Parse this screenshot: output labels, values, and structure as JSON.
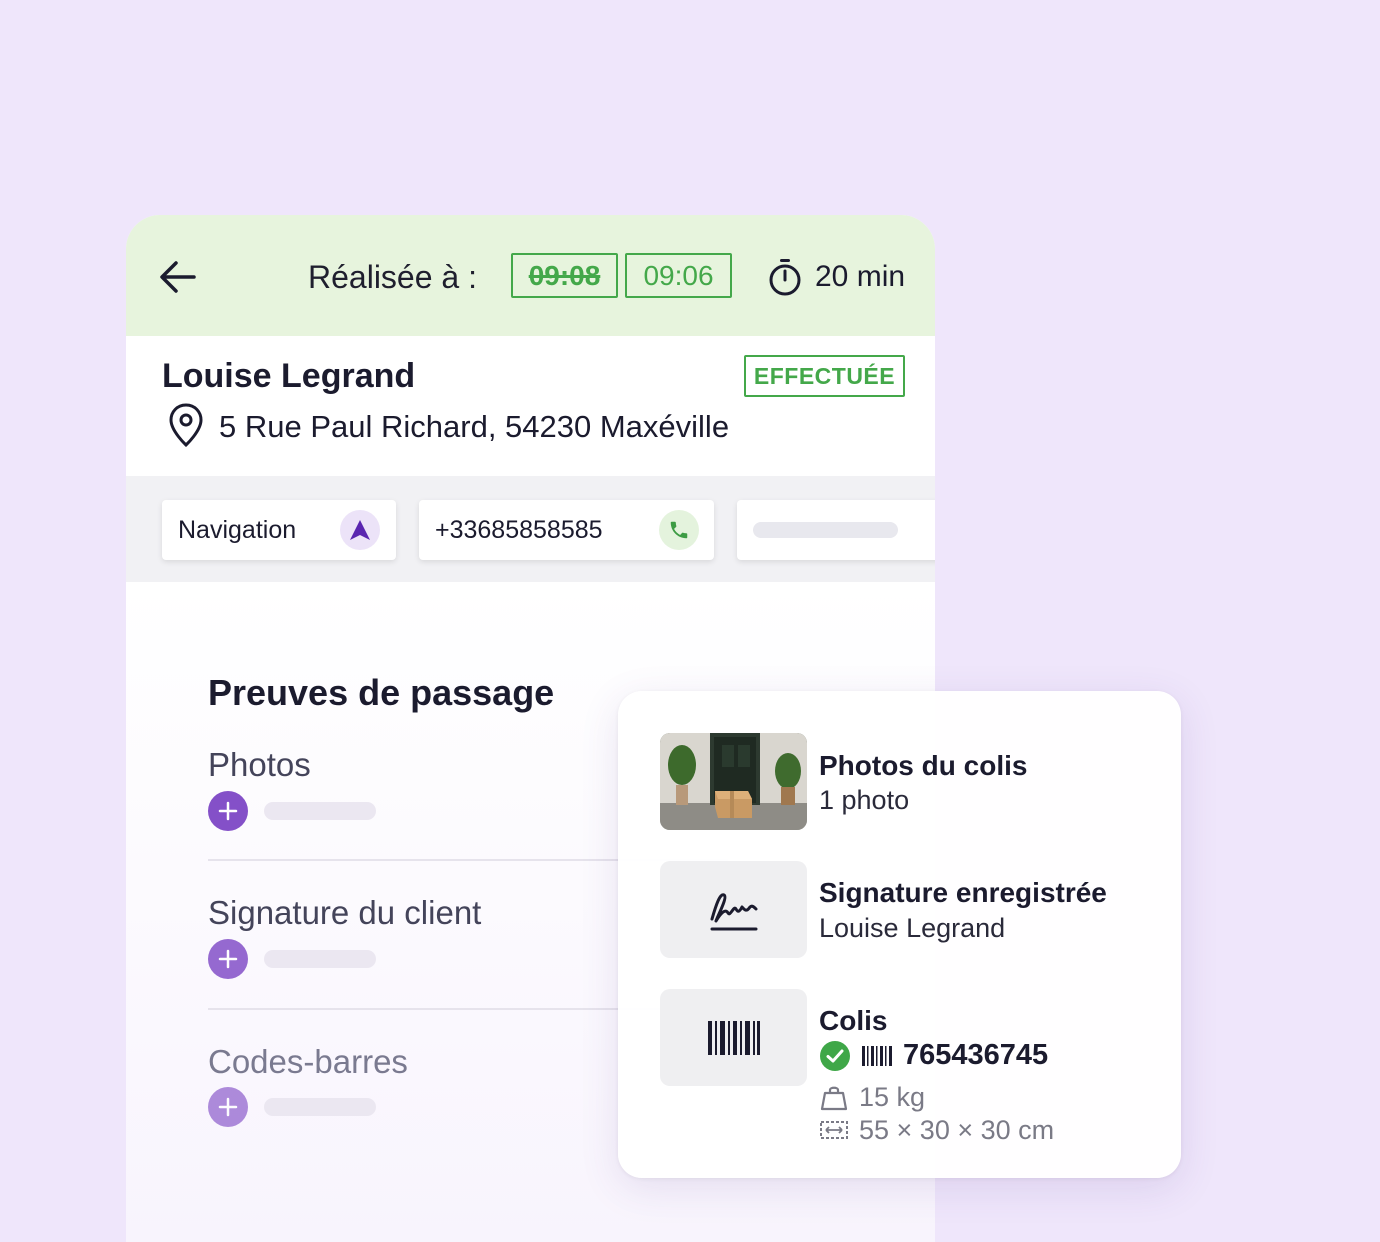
{
  "header": {
    "realisee_label": "Réalisée à :",
    "time_old": "09:08",
    "time_new": "09:06",
    "duration": "20 min",
    "icons": [
      "arrow-left-icon",
      "stopwatch-icon"
    ]
  },
  "stop": {
    "name": "Louise Legrand",
    "status": "EFFECTUÉE",
    "address": "5 Rue Paul Richard, 54230 Maxéville"
  },
  "actions": {
    "navigation_label": "Navigation",
    "phone_label": "+33685858585"
  },
  "proofs": {
    "title": "Preuves de passage",
    "items": [
      {
        "label": "Photos"
      },
      {
        "label": "Signature du client"
      },
      {
        "label": "Codes-barres"
      }
    ]
  },
  "summary": {
    "photos": {
      "title": "Photos du colis",
      "subtitle": "1 photo"
    },
    "signature": {
      "title": "Signature enregistrée",
      "subtitle": "Louise Legrand"
    },
    "parcel": {
      "title": "Colis",
      "barcode": "765436745",
      "weight": "15 kg",
      "dimensions": "55 × 30 × 30 cm"
    }
  },
  "colors": {
    "header_bg": "#e7f4dd",
    "success": "#44a84a",
    "accent": "#8450c8",
    "page_bg": "#efe6fb"
  }
}
